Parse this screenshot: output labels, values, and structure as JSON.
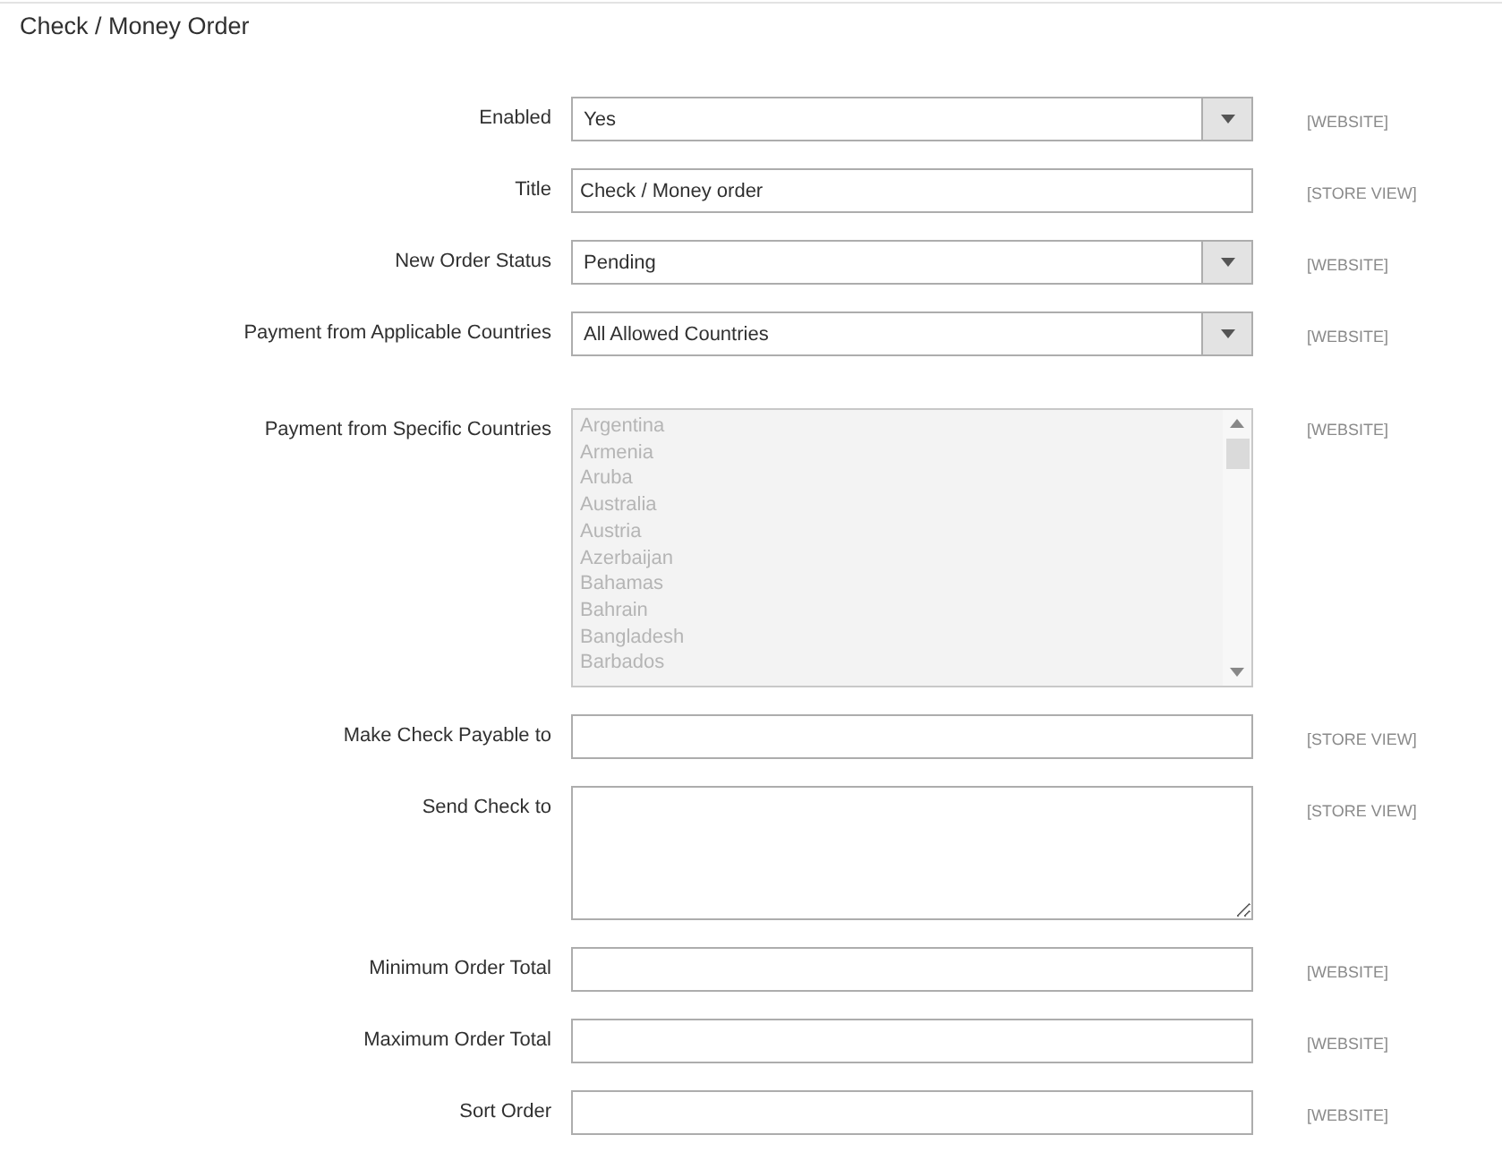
{
  "section": {
    "title": "Check / Money Order"
  },
  "fields": [
    {
      "kind": "select",
      "label": "Enabled",
      "value": "Yes",
      "scope": "[WEBSITE]"
    },
    {
      "kind": "text",
      "label": "Title",
      "value": "Check / Money order",
      "scope": "[STORE VIEW]"
    },
    {
      "kind": "select",
      "label": "New Order Status",
      "value": "Pending",
      "scope": "[WEBSITE]"
    },
    {
      "kind": "select",
      "label": "Payment from Applicable Countries",
      "value": "All Allowed Countries",
      "scope": "[WEBSITE]"
    },
    {
      "kind": "multiselect",
      "label": "Payment from Specific Countries",
      "disabled": true,
      "options": [
        "Argentina",
        "Armenia",
        "Aruba",
        "Australia",
        "Austria",
        "Azerbaijan",
        "Bahamas",
        "Bahrain",
        "Bangladesh",
        "Barbados"
      ],
      "scope": "[WEBSITE]"
    },
    {
      "kind": "text",
      "label": "Make Check Payable to",
      "scope": "[STORE VIEW]"
    },
    {
      "kind": "textarea",
      "label": "Send Check to",
      "scope": "[STORE VIEW]"
    },
    {
      "kind": "text",
      "label": "Minimum Order Total",
      "scope": "[WEBSITE]"
    },
    {
      "kind": "text",
      "label": "Maximum Order Total",
      "scope": "[WEBSITE]"
    },
    {
      "kind": "text",
      "label": "Sort Order",
      "scope": "[WEBSITE]"
    }
  ]
}
